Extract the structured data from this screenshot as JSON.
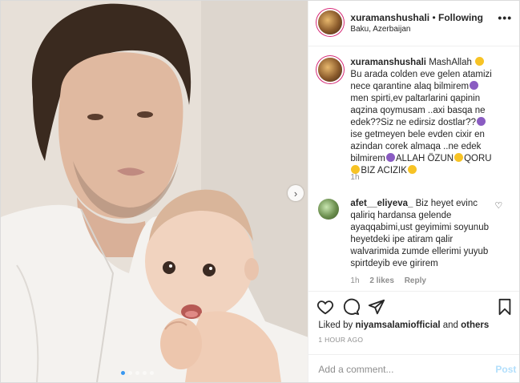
{
  "header": {
    "username": "xuramanshushali",
    "separator": " • ",
    "follow_status": "Following",
    "location": "Baku, Azerbaijan",
    "more_icon": "more-horizontal-icon"
  },
  "caption": {
    "username": "xuramanshushali",
    "text_1": " MashAllah ",
    "text_2": " Bu arada colden eve gelen atamizi nece qarantine alaq bilmirem",
    "text_3": "men spirti,ev paltarlarini qapinin aqzina qoymusam ..axi basqa ne edek??Siz ne edirsiz dostlar??",
    "text_4": "ise getmeyen bele evden cixir en azindan corek almaqa ..ne edek bilmirem",
    "text_5": "ALLAH ÖZUN",
    "text_6": "QORU",
    "text_7": "BIZ ACIZIK",
    "time": "1h"
  },
  "comment": {
    "username": "afet__eliyeva_",
    "text": " Biz heyet evinc qaliriq hardansa gelende ayaqqabimi,ust geyimimi soyunub heyetdeki ipe atiram qalir walvarimida zumde ellerimi yuyub spirtdeyib eve girirem",
    "time": "1h",
    "likes": "2 likes",
    "reply": "Reply"
  },
  "likes": {
    "prefix": "Liked by ",
    "user": "niyamsalamiofficial",
    "middle": " and ",
    "others": "others"
  },
  "time_ago": "1 HOUR AGO",
  "add_comment": {
    "placeholder": "Add a comment...",
    "post": "Post"
  },
  "carousel": {
    "current": 1,
    "total": 5
  }
}
